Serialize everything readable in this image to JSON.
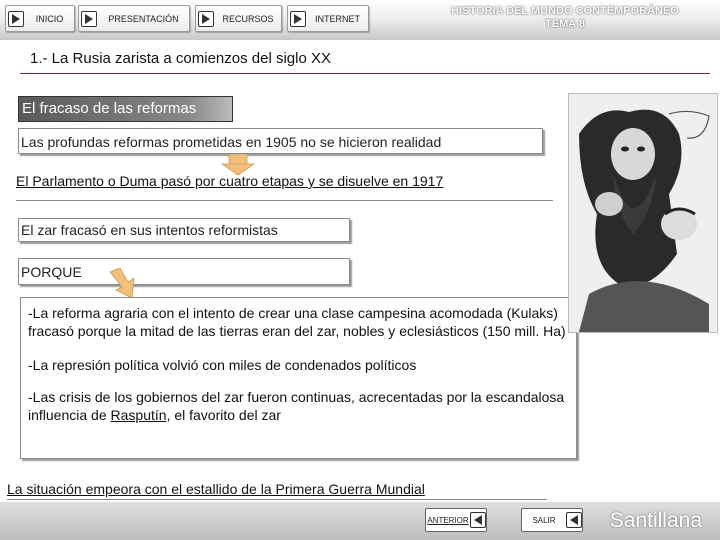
{
  "nav": {
    "inicio": "INICIO",
    "presentacion": "PRESENTACIÓN",
    "recursos": "RECURSOS",
    "internet": "INTERNET"
  },
  "unit": {
    "line1": "HISTORIA DEL MUNDO CONTEMPORÁNEO",
    "line2": "TEMA 8"
  },
  "section_title": "1.- La Rusia zarista a comienzos del siglo XX",
  "subtitle": "El fracaso de las reformas",
  "content": {
    "box1": "Las profundas reformas prometidas en 1905 no se hicieron realidad",
    "duma": "El Parlamento o Duma pasó por cuatro etapas y se disuelve en 1917",
    "box2": "El zar fracasó en sus intentos reformistas",
    "box3": "PORQUE",
    "reason1": "-La reforma agraria con el intento de crear una clase campesina acomodada (Kulaks) fracasó porque la mitad de las tierras eran del zar, nobles y eclesiásticos (150 mill. Ha)",
    "reason2": "-La represión política volvió con miles de condenados políticos",
    "reason3_pre": "-Las crisis de los gobiernos del zar fueron continuas, acrecentadas por la escandalosa influencia de ",
    "reason3_link": "Rasputín",
    "reason3_post": ", el favorito del zar",
    "war": "La situación empeora con el estallido de la Primera Guerra Mundial"
  },
  "footer": {
    "anterior": "ANTERIOR",
    "salir": "SALIR",
    "brand": "Santillana"
  },
  "colors": {
    "rule": "#7a2140",
    "arrow": "#f2bf7a"
  },
  "icons": {
    "nav_arrow": "play-right-icon",
    "prev_arrow": "play-left-icon",
    "salir_arrow": "play-left-icon",
    "flow_arrow_down": "arrow-down-icon",
    "flow_arrow_bend": "arrow-bend-icon"
  }
}
